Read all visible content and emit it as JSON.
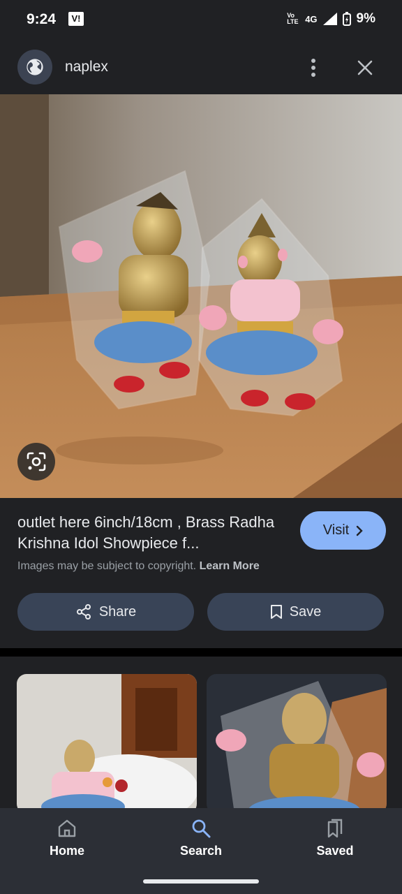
{
  "status": {
    "time": "9:24",
    "carrier_badge": "V!",
    "volte": "Vo LTE",
    "network": "4G",
    "battery": "9%"
  },
  "header": {
    "site_name": "naplex",
    "icons": [
      "globe-icon",
      "more-vert-icon",
      "close-icon"
    ]
  },
  "hero": {
    "lens_icon": "google-lens-icon"
  },
  "result": {
    "title": "outlet here 6inch/18cm , Brass Radha Krishna Idol Showpiece f...",
    "copyright_text": "Images may be subject to copyright.",
    "learn_more": "Learn More",
    "visit_label": "Visit",
    "share_label": "Share",
    "save_label": "Save"
  },
  "nav": {
    "items": [
      {
        "label": "Home",
        "icon": "home-icon"
      },
      {
        "label": "Search",
        "icon": "search-icon"
      },
      {
        "label": "Saved",
        "icon": "bookmarks-icon"
      }
    ]
  },
  "colors": {
    "background": "#202124",
    "accent": "#8ab4f8",
    "button_bg": "#394457",
    "nav_bg": "#2c2f36"
  }
}
